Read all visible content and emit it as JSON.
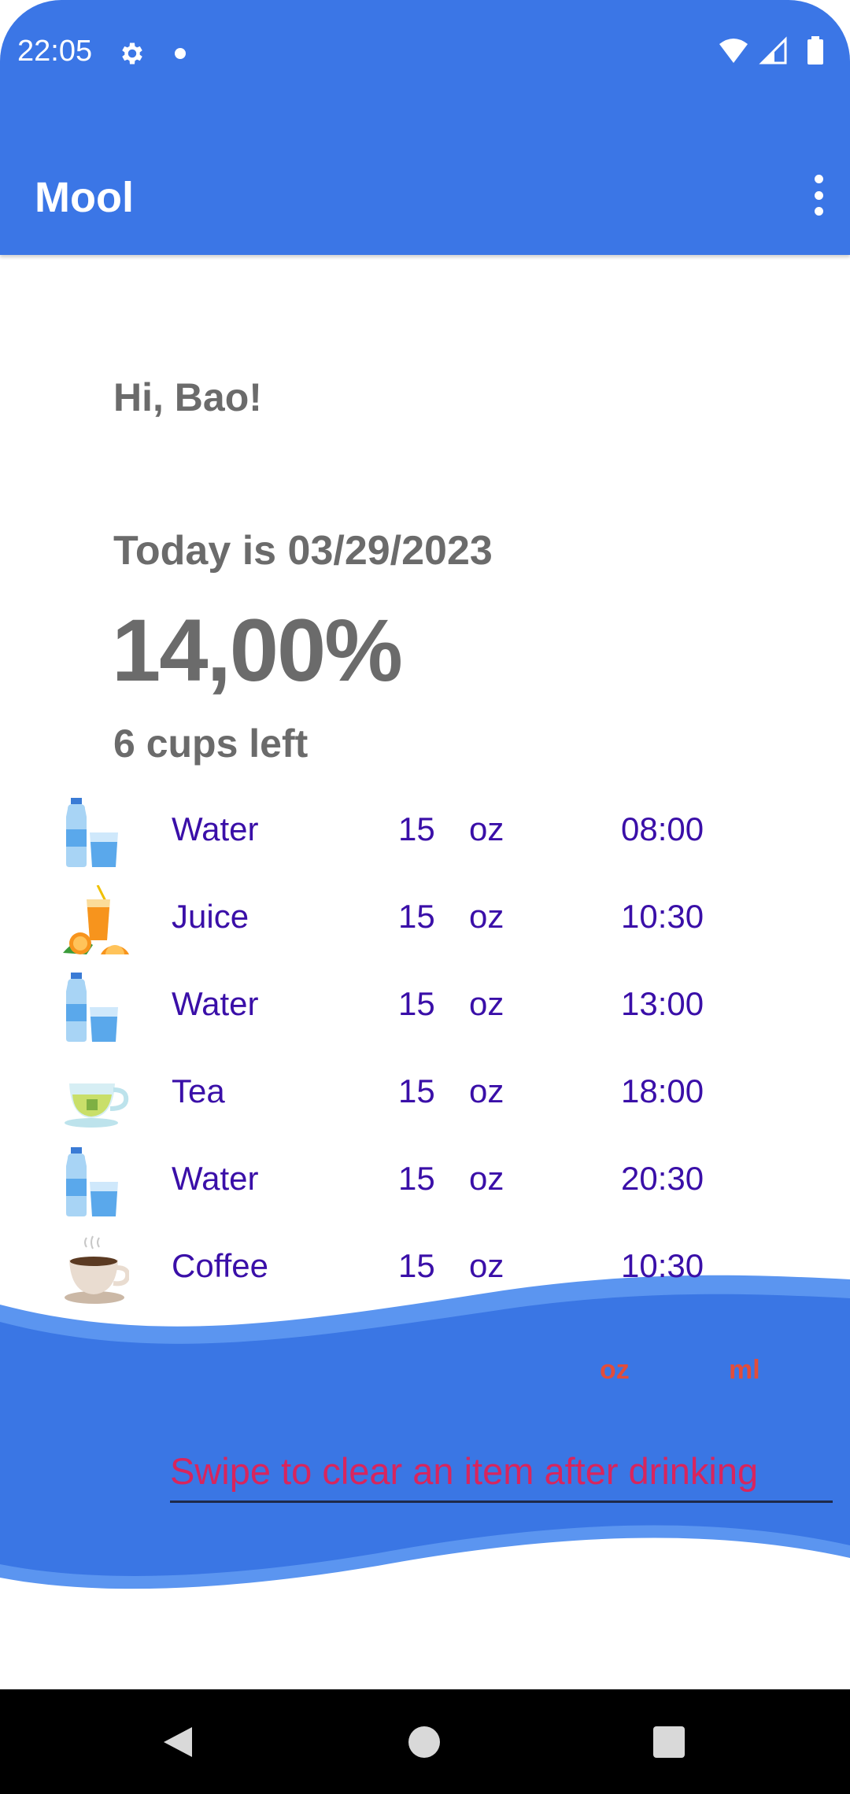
{
  "status_bar": {
    "time": "22:05"
  },
  "app_bar": {
    "title": "Mool"
  },
  "content": {
    "greeting": "Hi, Bao!",
    "date_line": "Today is 03/29/2023",
    "percent": "14,00%",
    "cups_left": "6 cups left"
  },
  "drinks": [
    {
      "name": "Water",
      "amount": "15",
      "unit": "oz",
      "time": "08:00",
      "icon": "water-bottle-icon"
    },
    {
      "name": "Juice",
      "amount": "15",
      "unit": "oz",
      "time": "10:30",
      "icon": "orange-juice-icon"
    },
    {
      "name": "Water",
      "amount": "15",
      "unit": "oz",
      "time": "13:00",
      "icon": "water-bottle-icon"
    },
    {
      "name": "Tea",
      "amount": "15",
      "unit": "oz",
      "time": "18:00",
      "icon": "tea-cup-icon"
    },
    {
      "name": "Water",
      "amount": "15",
      "unit": "oz",
      "time": "20:30",
      "icon": "water-bottle-icon"
    },
    {
      "name": "Coffee",
      "amount": "15",
      "unit": "oz",
      "time": "10:30",
      "icon": "coffee-cup-icon"
    }
  ],
  "bottom_panel": {
    "unit_oz": "oz",
    "unit_ml": "ml",
    "hint": "Swipe to clear an item after drinking"
  },
  "colors": {
    "primary": "#3b76e6",
    "list_text": "#3a0fa8",
    "heading_text": "#6b6b6b",
    "unit_toggle": "#e24d3a",
    "hint_text": "#d8255d"
  }
}
